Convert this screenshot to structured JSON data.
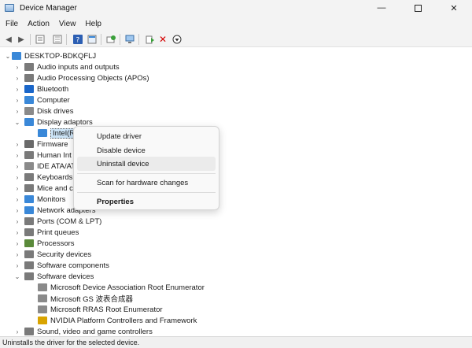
{
  "window": {
    "title": "Device Manager",
    "minimize": "—",
    "close": "✕"
  },
  "menu": [
    "File",
    "Action",
    "View",
    "Help"
  ],
  "toolbar_icons": [
    "back-arrow-icon",
    "forward-arrow-icon",
    "properties-icon",
    "list-icon",
    "help-icon",
    "view-icon",
    "scan-icon",
    "monitor-icon",
    "update-driver-icon",
    "uninstall-icon",
    "download-icon"
  ],
  "tree": {
    "root": "DESKTOP-BDKQFLJ",
    "items": [
      {
        "label": "Audio inputs and outputs",
        "icon": "speaker-icon",
        "color": "#7a7a7a"
      },
      {
        "label": "Audio Processing Objects (APOs)",
        "icon": "speaker-icon",
        "color": "#7a7a7a"
      },
      {
        "label": "Bluetooth",
        "icon": "bluetooth-icon",
        "color": "#1a66c9"
      },
      {
        "label": "Computer",
        "icon": "computer-icon",
        "color": "#3a88d8"
      },
      {
        "label": "Disk drives",
        "icon": "disk-icon",
        "color": "#8a8a8a"
      },
      {
        "label": "Display adaptors",
        "icon": "display-icon",
        "color": "#3a88d8"
      },
      {
        "label": "Intel(R)",
        "icon": "display-icon",
        "color": "#3a88d8"
      },
      {
        "label": "Firmware",
        "icon": "firmware-icon",
        "color": "#6a6a6a"
      },
      {
        "label": "Human Int",
        "icon": "hid-icon",
        "color": "#7a7a7a"
      },
      {
        "label": "IDE ATA/AT",
        "icon": "ide-icon",
        "color": "#8a8a8a"
      },
      {
        "label": "Keyboards",
        "icon": "keyboard-icon",
        "color": "#7a7a7a"
      },
      {
        "label": "Mice and c",
        "icon": "mouse-icon",
        "color": "#7a7a7a"
      },
      {
        "label": "Monitors",
        "icon": "monitor-icon",
        "color": "#3a88d8"
      },
      {
        "label": "Network adapters",
        "icon": "network-icon",
        "color": "#3a88d8"
      },
      {
        "label": "Ports (COM & LPT)",
        "icon": "port-icon",
        "color": "#7a7a7a"
      },
      {
        "label": "Print queues",
        "icon": "printer-icon",
        "color": "#7a7a7a"
      },
      {
        "label": "Processors",
        "icon": "processor-icon",
        "color": "#5a8a3a"
      },
      {
        "label": "Security devices",
        "icon": "security-icon",
        "color": "#7a7a7a"
      },
      {
        "label": "Software components",
        "icon": "component-icon",
        "color": "#7a7a7a"
      },
      {
        "label": "Software devices",
        "icon": "software-device-icon",
        "color": "#7a7a7a"
      },
      {
        "label": "Microsoft Device Association Root Enumerator",
        "icon": "device-icon",
        "color": "#8a8a8a"
      },
      {
        "label": "Microsoft GS 波表合成器",
        "icon": "device-icon",
        "color": "#8a8a8a"
      },
      {
        "label": "Microsoft RRAS Root Enumerator",
        "icon": "device-icon",
        "color": "#8a8a8a"
      },
      {
        "label": "NVIDIA Platform Controllers and Framework",
        "icon": "warning-device-icon",
        "color": "#d9a400"
      },
      {
        "label": "Sound, video and game controllers",
        "icon": "speaker-icon",
        "color": "#7a7a7a"
      }
    ]
  },
  "context_menu": {
    "update": "Update driver",
    "disable": "Disable device",
    "uninstall": "Uninstall device",
    "scan": "Scan for hardware changes",
    "properties": "Properties"
  },
  "status": "Uninstalls the driver for the selected device."
}
